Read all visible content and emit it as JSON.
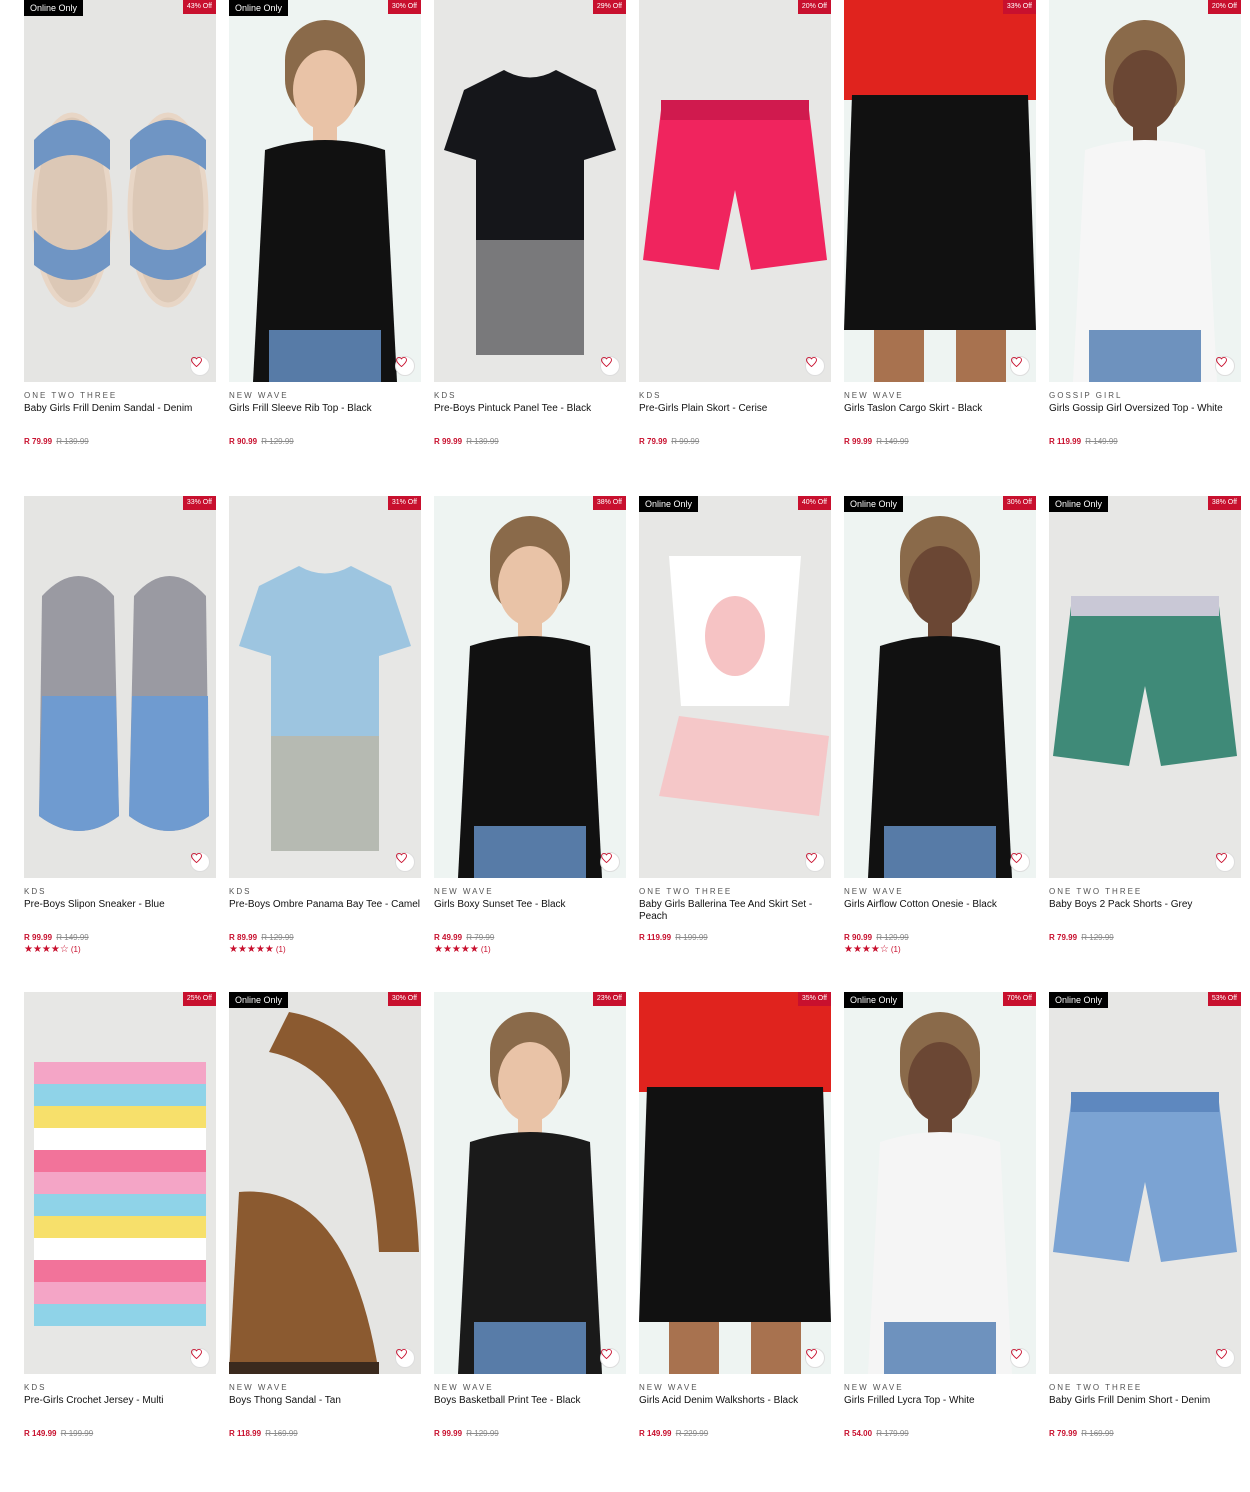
{
  "colors": {
    "sale": "#c8102e",
    "badge_online": "#000000"
  },
  "labels": {
    "online_only": "Online Only"
  },
  "products": [
    {
      "brand": "ONE TWO THREE",
      "title": "Baby Girls Frill Denim Sandal - Denim",
      "price": "R 79.99",
      "was": "R 139.99",
      "discount": "43% Off",
      "online_only": true,
      "rating": null,
      "icon": "sandal",
      "bg": "#e5e5e3",
      "main": "#6f95c4",
      "accent": "#e8d6c6"
    },
    {
      "brand": "NEW WAVE",
      "title": "Girls Frill Sleeve Rib Top - Black",
      "price": "R 90.99",
      "was": "R 129.99",
      "discount": "30% Off",
      "online_only": true,
      "rating": null,
      "icon": "person",
      "bg": "#eef4f2",
      "main": "#111111",
      "accent": "#e9c3a7"
    },
    {
      "brand": "KDS",
      "title": "Pre-Boys Pintuck Panel Tee - Black",
      "price": "R 99.99",
      "was": "R 139.99",
      "discount": "29% Off",
      "online_only": false,
      "rating": null,
      "icon": "tee",
      "bg": "#e7e7e5",
      "main": "#15161a",
      "accent": "#cccccc"
    },
    {
      "brand": "KDS",
      "title": "Pre-Girls Plain Skort - Cerise",
      "price": "R 79.99",
      "was": "R 99.99",
      "discount": "20% Off",
      "online_only": false,
      "rating": null,
      "icon": "shorts",
      "bg": "#e7e7e5",
      "main": "#f0245e",
      "accent": "#d01a4e"
    },
    {
      "brand": "NEW WAVE",
      "title": "Girls Taslon Cargo Skirt - Black",
      "price": "R 99.99",
      "was": "R 149.99",
      "discount": "33% Off",
      "online_only": false,
      "rating": null,
      "icon": "skirt",
      "bg": "#eef4f2",
      "main": "#111111",
      "accent": "#e0231e"
    },
    {
      "brand": "GOSSIP GIRL",
      "title": "Girls Gossip Girl Oversized Top - White",
      "price": "R 119.99",
      "was": "R 149.99",
      "discount": "20% Off",
      "online_only": false,
      "rating": null,
      "icon": "person",
      "bg": "#eef4f2",
      "main": "#f6f6f6",
      "accent": "#6b4734"
    },
    {
      "brand": "KDS",
      "title": "Pre-Boys Slipon Sneaker - Blue",
      "price": "R 99.99",
      "was": "R 149.99",
      "discount": "33% Off",
      "online_only": false,
      "rating": {
        "text": "★★★★☆",
        "count": "(1)"
      },
      "icon": "sneaker",
      "bg": "#e5e5e3",
      "main": "#6f9bd0",
      "accent": "#9a9aa2"
    },
    {
      "brand": "KDS",
      "title": "Pre-Boys Ombre Panama Bay Tee - Camel",
      "price": "R 89.99",
      "was": "R 129.99",
      "discount": "31% Off",
      "online_only": false,
      "rating": {
        "text": "★★★★★",
        "count": "(1)"
      },
      "icon": "tee",
      "bg": "#e7e7e5",
      "main": "#9dc5e0",
      "accent": "#cbb08c"
    },
    {
      "brand": "NEW WAVE",
      "title": "Girls Boxy Sunset Tee - Black",
      "price": "R 49.99",
      "was": "R 79.99",
      "discount": "38% Off",
      "online_only": false,
      "rating": {
        "text": "★★★★★",
        "count": "(1)"
      },
      "icon": "person",
      "bg": "#eef4f2",
      "main": "#111111",
      "accent": "#e9c3a7"
    },
    {
      "brand": "ONE TWO THREE",
      "title": "Baby Girls Ballerina Tee And Skirt Set - Peach",
      "price": "R 119.99",
      "was": "R 199.99",
      "discount": "40% Off",
      "online_only": true,
      "rating": null,
      "icon": "dress",
      "bg": "#e7e7e5",
      "main": "#f6c3c4",
      "accent": "#ffffff"
    },
    {
      "brand": "NEW WAVE",
      "title": "Girls Airflow Cotton Onesie - Black",
      "price": "R 90.99",
      "was": "R 129.99",
      "discount": "30% Off",
      "online_only": true,
      "rating": {
        "text": "★★★★☆",
        "count": "(1)"
      },
      "icon": "person",
      "bg": "#eef4f2",
      "main": "#111111",
      "accent": "#6b4734"
    },
    {
      "brand": "ONE TWO THREE",
      "title": "Baby Boys 2 Pack Shorts - Grey",
      "price": "R 79.99",
      "was": "R 129.99",
      "discount": "38% Off",
      "online_only": true,
      "rating": null,
      "icon": "shorts",
      "bg": "#e7e7e5",
      "main": "#3f8a78",
      "accent": "#c9c8d6"
    },
    {
      "brand": "KDS",
      "title": "Pre-Girls Crochet Jersey - Multi",
      "price": "R 149.99",
      "was": "R 199.99",
      "discount": "25% Off",
      "online_only": false,
      "rating": null,
      "icon": "jersey",
      "bg": "#e7e7e5",
      "main": "#f4a5c6",
      "accent": "#8fd3e8"
    },
    {
      "brand": "NEW WAVE",
      "title": "Boys Thong Sandal - Tan",
      "price": "R 118.99",
      "was": "R 169.99",
      "discount": "30% Off",
      "online_only": true,
      "rating": null,
      "icon": "flipflop",
      "bg": "#e5e5e3",
      "main": "#8b5a30",
      "accent": "#3b2a1e"
    },
    {
      "brand": "NEW WAVE",
      "title": "Boys Basketball Print Tee - Black",
      "price": "R 99.99",
      "was": "R 129.99",
      "discount": "23% Off",
      "online_only": false,
      "rating": null,
      "icon": "person",
      "bg": "#eef4f2",
      "main": "#1a1a1a",
      "accent": "#e9c3a7"
    },
    {
      "brand": "NEW WAVE",
      "title": "Girls Acid Denim Walkshorts - Black",
      "price": "R 149.99",
      "was": "R 229.99",
      "discount": "35% Off",
      "online_only": false,
      "rating": null,
      "icon": "skirt",
      "bg": "#eef4f2",
      "main": "#111111",
      "accent": "#e0231e"
    },
    {
      "brand": "NEW WAVE",
      "title": "Girls Frilled Lycra Top - White",
      "price": "R 54.00",
      "was": "R 179.99",
      "discount": "70% Off",
      "online_only": true,
      "rating": null,
      "icon": "person",
      "bg": "#eef4f2",
      "main": "#f5f5f5",
      "accent": "#6b4734"
    },
    {
      "brand": "ONE TWO THREE",
      "title": "Baby Girls Frill Denim Short - Denim",
      "price": "R 79.99",
      "was": "R 169.99",
      "discount": "53% Off",
      "online_only": true,
      "rating": null,
      "icon": "shorts",
      "bg": "#e7e7e5",
      "main": "#7ba3d3",
      "accent": "#5e88bf"
    }
  ]
}
